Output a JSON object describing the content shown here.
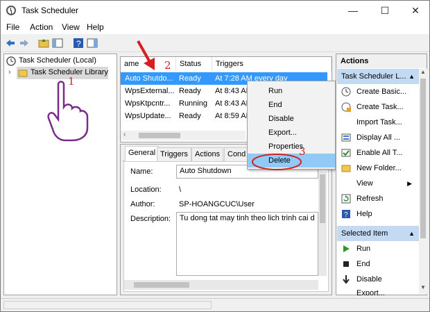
{
  "window": {
    "title": "Task Scheduler",
    "minimize_glyph": "—",
    "maximize_glyph": "☐",
    "close_glyph": "✕"
  },
  "menu": {
    "file": "File",
    "action": "Action",
    "view": "View",
    "help": "Help"
  },
  "tree": {
    "root": "Task Scheduler (Local)",
    "library": "Task Scheduler Library"
  },
  "task_table": {
    "columns": [
      "ame",
      "Status",
      "Triggers"
    ],
    "rows": [
      {
        "name": "Auto Shutdo...",
        "status": "Ready",
        "trigger": "At 7:28 AM every day"
      },
      {
        "name": "WpsExternal...",
        "status": "Ready",
        "trigger": "At 8:43 AM"
      },
      {
        "name": "WpsKtpcntr...",
        "status": "Running",
        "trigger": "At 8:43 AM"
      },
      {
        "name": "WpsUpdate...",
        "status": "Ready",
        "trigger": "At 8:59 AM"
      }
    ]
  },
  "context_menu": {
    "items": [
      "Run",
      "End",
      "Disable",
      "Export...",
      "Properties",
      "Delete"
    ]
  },
  "detail": {
    "tabs": [
      "General",
      "Triggers",
      "Actions",
      "Cond"
    ],
    "name_label": "Name:",
    "name_value": "Auto Shutdown",
    "location_label": "Location:",
    "location_value": "\\",
    "author_label": "Author:",
    "author_value": "SP-HOANGCUC\\User",
    "description_label": "Description:",
    "description_value": "Tu dong tat may tinh theo lich trinh cai d"
  },
  "actions": {
    "header": "Actions",
    "section1": "Task Scheduler L...",
    "section1_items": [
      {
        "label": "Create Basic...",
        "icon": "create-basic-task-icon"
      },
      {
        "label": "Create Task...",
        "icon": "create-task-icon"
      },
      {
        "label": "Import Task...",
        "icon": "none"
      },
      {
        "label": "Display All ...",
        "icon": "display-running-icon"
      },
      {
        "label": "Enable All T...",
        "icon": "enable-history-icon"
      },
      {
        "label": "New Folder...",
        "icon": "folder-icon"
      },
      {
        "label": "View",
        "icon": "none"
      },
      {
        "label": "Refresh",
        "icon": "refresh-icon"
      },
      {
        "label": "Help",
        "icon": "help-icon"
      }
    ],
    "section2": "Selected Item",
    "section2_items": [
      {
        "label": "Run",
        "icon": "run-icon"
      },
      {
        "label": "End",
        "icon": "end-icon"
      },
      {
        "label": "Disable",
        "icon": "disable-icon"
      },
      {
        "label": "Export...",
        "icon": "none"
      }
    ]
  },
  "annotations": {
    "step1": "1",
    "step2": "2",
    "step3": "3"
  },
  "colors": {
    "selection": "#3399ff",
    "context_highlight": "#91c9f7",
    "actions_header": "#c3daf3",
    "annotation_red": "#d42020"
  }
}
